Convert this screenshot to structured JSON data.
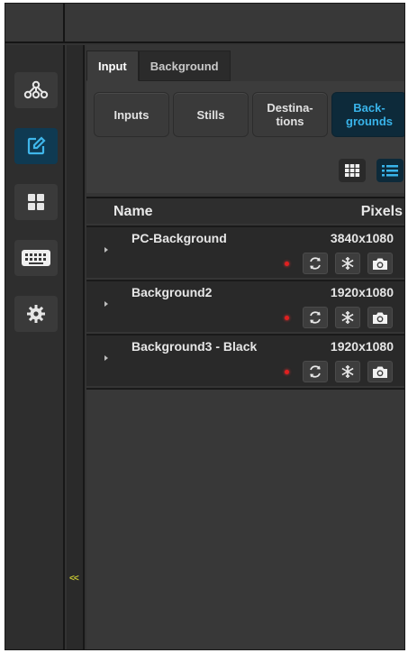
{
  "tabs": [
    {
      "label": "Input",
      "active": true
    },
    {
      "label": "Background",
      "active": false
    }
  ],
  "segments": [
    {
      "label": "Inputs",
      "selected": false
    },
    {
      "label": "Stills",
      "selected": false
    },
    {
      "label_line1": "Destina-",
      "label_line2": "tions",
      "selected": false
    },
    {
      "label_line1": "Back-",
      "label_line2": "grounds",
      "selected": true
    }
  ],
  "view_toggle": {
    "grid_icon": "grid-view-icon",
    "list_icon": "list-view-icon",
    "selected": "list"
  },
  "table": {
    "columns": [
      "Name",
      "Pixels"
    ],
    "rows": [
      {
        "name": "PC-Background",
        "pixels": "3840x1080"
      },
      {
        "name": "Background2",
        "pixels": "1920x1080"
      },
      {
        "name": "Background3 - Black",
        "pixels": "1920x1080"
      }
    ]
  },
  "rail_icons": [
    "network-icon",
    "edit-icon",
    "layout-icon",
    "keyboard-icon",
    "gear-icon"
  ],
  "collapse_label": "<<",
  "colors": {
    "accent": "#39b4ea",
    "selected_bg": "#0d2a3a",
    "status_dot": "#e02020",
    "collapse": "#c8c832"
  }
}
